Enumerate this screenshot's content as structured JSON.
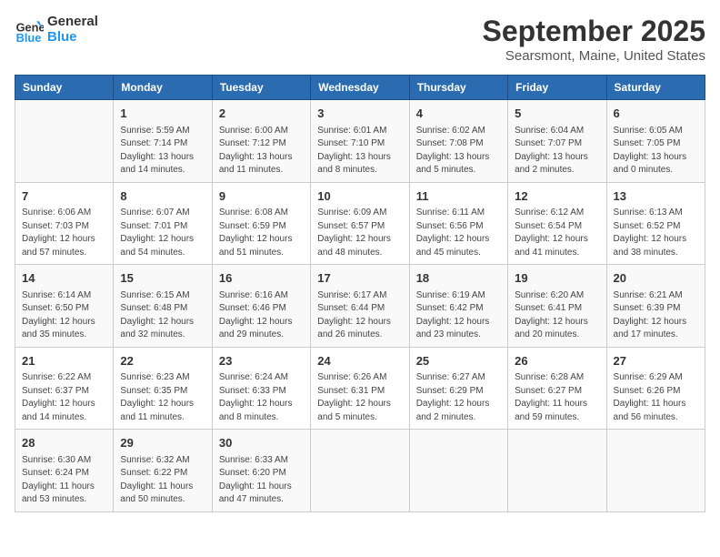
{
  "header": {
    "logo_line1": "General",
    "logo_line2": "Blue",
    "month": "September 2025",
    "location": "Searsmont, Maine, United States"
  },
  "days_of_week": [
    "Sunday",
    "Monday",
    "Tuesday",
    "Wednesday",
    "Thursday",
    "Friday",
    "Saturday"
  ],
  "weeks": [
    [
      {
        "day": "",
        "info": ""
      },
      {
        "day": "1",
        "info": "Sunrise: 5:59 AM\nSunset: 7:14 PM\nDaylight: 13 hours\nand 14 minutes."
      },
      {
        "day": "2",
        "info": "Sunrise: 6:00 AM\nSunset: 7:12 PM\nDaylight: 13 hours\nand 11 minutes."
      },
      {
        "day": "3",
        "info": "Sunrise: 6:01 AM\nSunset: 7:10 PM\nDaylight: 13 hours\nand 8 minutes."
      },
      {
        "day": "4",
        "info": "Sunrise: 6:02 AM\nSunset: 7:08 PM\nDaylight: 13 hours\nand 5 minutes."
      },
      {
        "day": "5",
        "info": "Sunrise: 6:04 AM\nSunset: 7:07 PM\nDaylight: 13 hours\nand 2 minutes."
      },
      {
        "day": "6",
        "info": "Sunrise: 6:05 AM\nSunset: 7:05 PM\nDaylight: 13 hours\nand 0 minutes."
      }
    ],
    [
      {
        "day": "7",
        "info": "Sunrise: 6:06 AM\nSunset: 7:03 PM\nDaylight: 12 hours\nand 57 minutes."
      },
      {
        "day": "8",
        "info": "Sunrise: 6:07 AM\nSunset: 7:01 PM\nDaylight: 12 hours\nand 54 minutes."
      },
      {
        "day": "9",
        "info": "Sunrise: 6:08 AM\nSunset: 6:59 PM\nDaylight: 12 hours\nand 51 minutes."
      },
      {
        "day": "10",
        "info": "Sunrise: 6:09 AM\nSunset: 6:57 PM\nDaylight: 12 hours\nand 48 minutes."
      },
      {
        "day": "11",
        "info": "Sunrise: 6:11 AM\nSunset: 6:56 PM\nDaylight: 12 hours\nand 45 minutes."
      },
      {
        "day": "12",
        "info": "Sunrise: 6:12 AM\nSunset: 6:54 PM\nDaylight: 12 hours\nand 41 minutes."
      },
      {
        "day": "13",
        "info": "Sunrise: 6:13 AM\nSunset: 6:52 PM\nDaylight: 12 hours\nand 38 minutes."
      }
    ],
    [
      {
        "day": "14",
        "info": "Sunrise: 6:14 AM\nSunset: 6:50 PM\nDaylight: 12 hours\nand 35 minutes."
      },
      {
        "day": "15",
        "info": "Sunrise: 6:15 AM\nSunset: 6:48 PM\nDaylight: 12 hours\nand 32 minutes."
      },
      {
        "day": "16",
        "info": "Sunrise: 6:16 AM\nSunset: 6:46 PM\nDaylight: 12 hours\nand 29 minutes."
      },
      {
        "day": "17",
        "info": "Sunrise: 6:17 AM\nSunset: 6:44 PM\nDaylight: 12 hours\nand 26 minutes."
      },
      {
        "day": "18",
        "info": "Sunrise: 6:19 AM\nSunset: 6:42 PM\nDaylight: 12 hours\nand 23 minutes."
      },
      {
        "day": "19",
        "info": "Sunrise: 6:20 AM\nSunset: 6:41 PM\nDaylight: 12 hours\nand 20 minutes."
      },
      {
        "day": "20",
        "info": "Sunrise: 6:21 AM\nSunset: 6:39 PM\nDaylight: 12 hours\nand 17 minutes."
      }
    ],
    [
      {
        "day": "21",
        "info": "Sunrise: 6:22 AM\nSunset: 6:37 PM\nDaylight: 12 hours\nand 14 minutes."
      },
      {
        "day": "22",
        "info": "Sunrise: 6:23 AM\nSunset: 6:35 PM\nDaylight: 12 hours\nand 11 minutes."
      },
      {
        "day": "23",
        "info": "Sunrise: 6:24 AM\nSunset: 6:33 PM\nDaylight: 12 hours\nand 8 minutes."
      },
      {
        "day": "24",
        "info": "Sunrise: 6:26 AM\nSunset: 6:31 PM\nDaylight: 12 hours\nand 5 minutes."
      },
      {
        "day": "25",
        "info": "Sunrise: 6:27 AM\nSunset: 6:29 PM\nDaylight: 12 hours\nand 2 minutes."
      },
      {
        "day": "26",
        "info": "Sunrise: 6:28 AM\nSunset: 6:27 PM\nDaylight: 11 hours\nand 59 minutes."
      },
      {
        "day": "27",
        "info": "Sunrise: 6:29 AM\nSunset: 6:26 PM\nDaylight: 11 hours\nand 56 minutes."
      }
    ],
    [
      {
        "day": "28",
        "info": "Sunrise: 6:30 AM\nSunset: 6:24 PM\nDaylight: 11 hours\nand 53 minutes."
      },
      {
        "day": "29",
        "info": "Sunrise: 6:32 AM\nSunset: 6:22 PM\nDaylight: 11 hours\nand 50 minutes."
      },
      {
        "day": "30",
        "info": "Sunrise: 6:33 AM\nSunset: 6:20 PM\nDaylight: 11 hours\nand 47 minutes."
      },
      {
        "day": "",
        "info": ""
      },
      {
        "day": "",
        "info": ""
      },
      {
        "day": "",
        "info": ""
      },
      {
        "day": "",
        "info": ""
      }
    ]
  ]
}
